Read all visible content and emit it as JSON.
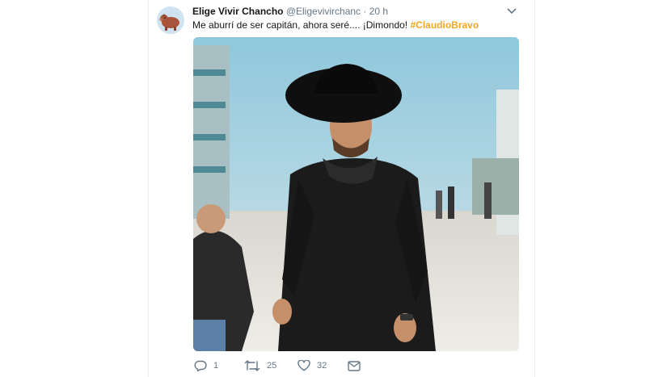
{
  "tweet": {
    "author_name": "Elige Vivir Chancho",
    "author_handle": "@Eligevivirchanc",
    "separator": "·",
    "time": "20 h",
    "text": "Me aburrí de ser capitán,  ahora seré.... ¡Dimondo!",
    "hashtag": "#ClaudioBravo"
  },
  "actions": {
    "reply_count": "1",
    "retweet_count": "25",
    "like_count": "32"
  },
  "icons": {
    "reply": "reply-icon",
    "retweet": "retweet-icon",
    "like": "heart-icon",
    "message": "envelope-icon",
    "menu": "chevron-down-icon"
  },
  "colors": {
    "hashtag": "#f5a623",
    "icon": "#657786",
    "border": "#e6ecf0"
  }
}
